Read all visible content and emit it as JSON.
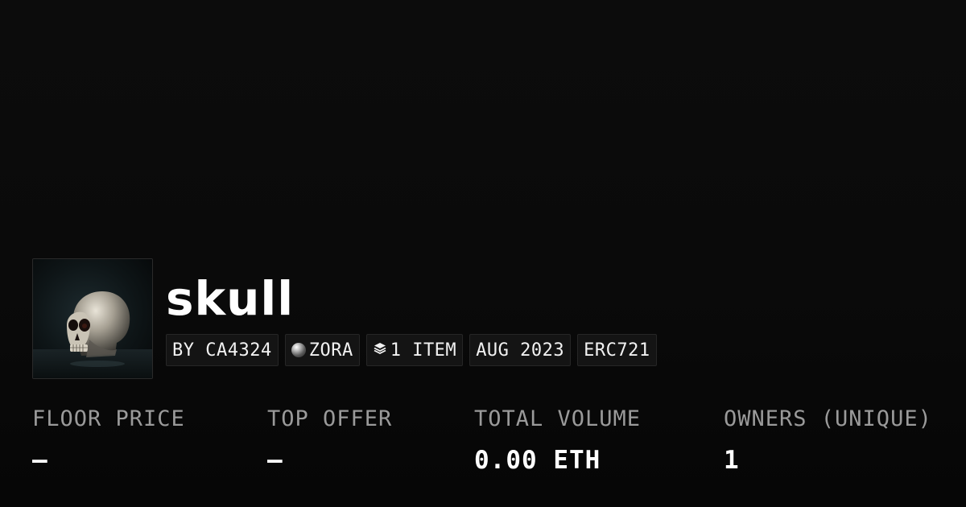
{
  "collection": {
    "title": "skull",
    "image_alt": "skull"
  },
  "badges": {
    "creator": "BY CA4324",
    "chain": "ZORA",
    "items": "1 ITEM",
    "date": "AUG 2023",
    "standard": "ERC721"
  },
  "icons": {
    "chain": "zora-orb-icon",
    "items": "layers-icon"
  },
  "stats": {
    "floor_price": {
      "label": "FLOOR PRICE",
      "value": "—"
    },
    "top_offer": {
      "label": "TOP OFFER",
      "value": "—"
    },
    "total_volume": {
      "label": "TOTAL VOLUME",
      "value": "0.00 ETH"
    },
    "owners": {
      "label": "OWNERS (UNIQUE)",
      "value": "1"
    }
  },
  "colors": {
    "background": "#0b0b0b",
    "badge_background": "#141414",
    "label_gray": "#9a9a9a",
    "text": "#ffffff"
  }
}
